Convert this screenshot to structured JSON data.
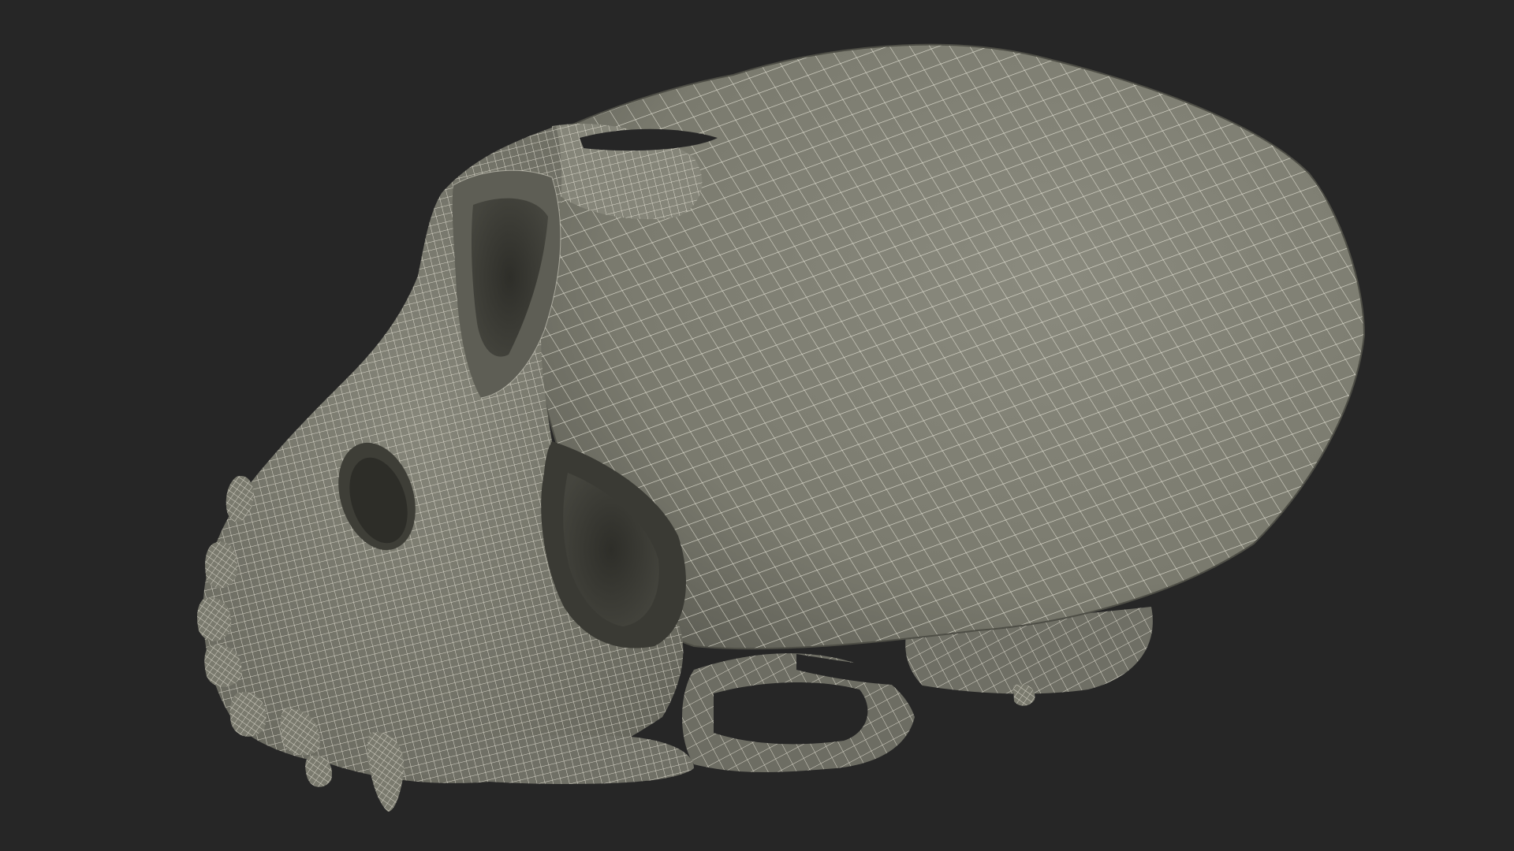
{
  "scene": {
    "subject": "wireframe-skull",
    "colors": {
      "background": "#262626",
      "surface": "#7a7a6e",
      "surface_light": "#8a8a7e",
      "surface_shadow": "#55554c",
      "cavity": "#3a3a34",
      "wire": "#ece9dc"
    }
  }
}
